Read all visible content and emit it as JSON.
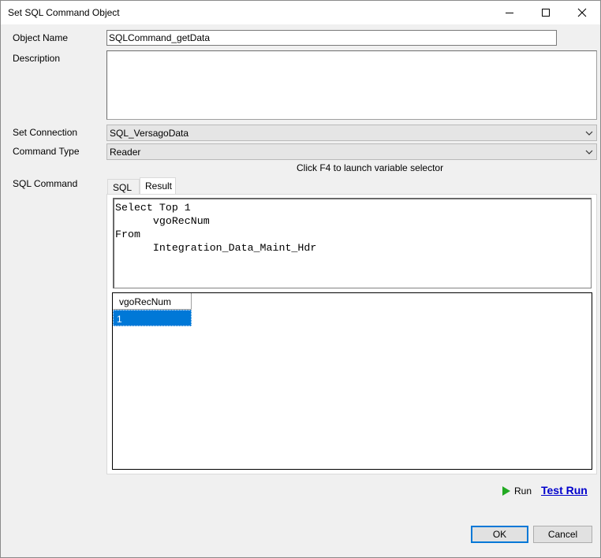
{
  "window": {
    "title": "Set SQL Command Object"
  },
  "form": {
    "object_name_label": "Object Name",
    "object_name_value": "SQLCommand_getData",
    "description_label": "Description",
    "description_value": "",
    "connection_label": "Set Connection",
    "connection_value": "SQL_VersagoData",
    "command_type_label": "Command Type",
    "command_type_value": "Reader",
    "hint": "Click F4 to launch variable selector",
    "sql_command_label": "SQL Command"
  },
  "tabs": [
    {
      "label": "SQL",
      "active": false
    },
    {
      "label": "Result",
      "active": true
    }
  ],
  "editor": {
    "lines": [
      "Select Top 1",
      "      vgoRecNum",
      "From",
      "      Integration_Data_Maint_Hdr"
    ]
  },
  "result_grid": {
    "columns": [
      "vgoRecNum"
    ],
    "rows": [
      [
        "1"
      ]
    ]
  },
  "actions": {
    "run_label": "Run",
    "test_run_label": "Test Run",
    "ok_label": "OK",
    "cancel_label": "Cancel"
  },
  "colors": {
    "selection": "#0078d7",
    "link": "#0000cc",
    "run_icon": "#22aa22"
  },
  "icons": {
    "minimize": "minimize-icon",
    "maximize": "maximize-icon",
    "close": "close-icon",
    "dropdown": "chevron-down-icon",
    "run": "play-icon"
  }
}
